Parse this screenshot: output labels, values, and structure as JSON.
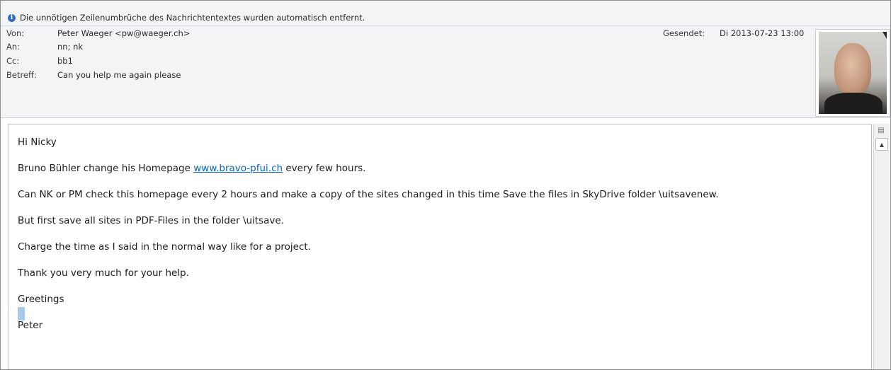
{
  "info_bar": {
    "icon": "info-icon",
    "text": "Die unnötigen Zeilenumbrüche des Nachrichtentextes wurden automatisch entfernt."
  },
  "header": {
    "from_label": "Von:",
    "from_value": "Peter Waeger <pw@waeger.ch>",
    "to_label": "An:",
    "to_value": "nn; nk",
    "cc_label": "Cc:",
    "cc_value": "bb1",
    "subject_label": "Betreff:",
    "subject_value": "Can you help me again please",
    "sent_label": "Gesendet:",
    "sent_value": "Di 2013-07-23 13:00"
  },
  "body": {
    "greeting": "Hi Nicky",
    "line1_before": "Bruno Bühler change his Homepage ",
    "line1_link": "www.bravo-pfui.ch",
    "line1_after": " every few hours.",
    "line2": "Can NK or PM check this homepage every 2 hours and make a copy of the sites changed in this time Save the files in SkyDrive folder \\uitsavenew.",
    "line3": "But first save all sites in PDF-Files in the folder  \\uitsave.",
    "line4": "Charge the time as I said in the normal way like for a project.",
    "line5": "Thank you very much for your help.",
    "closing": "Greetings",
    "signature": "Peter"
  }
}
